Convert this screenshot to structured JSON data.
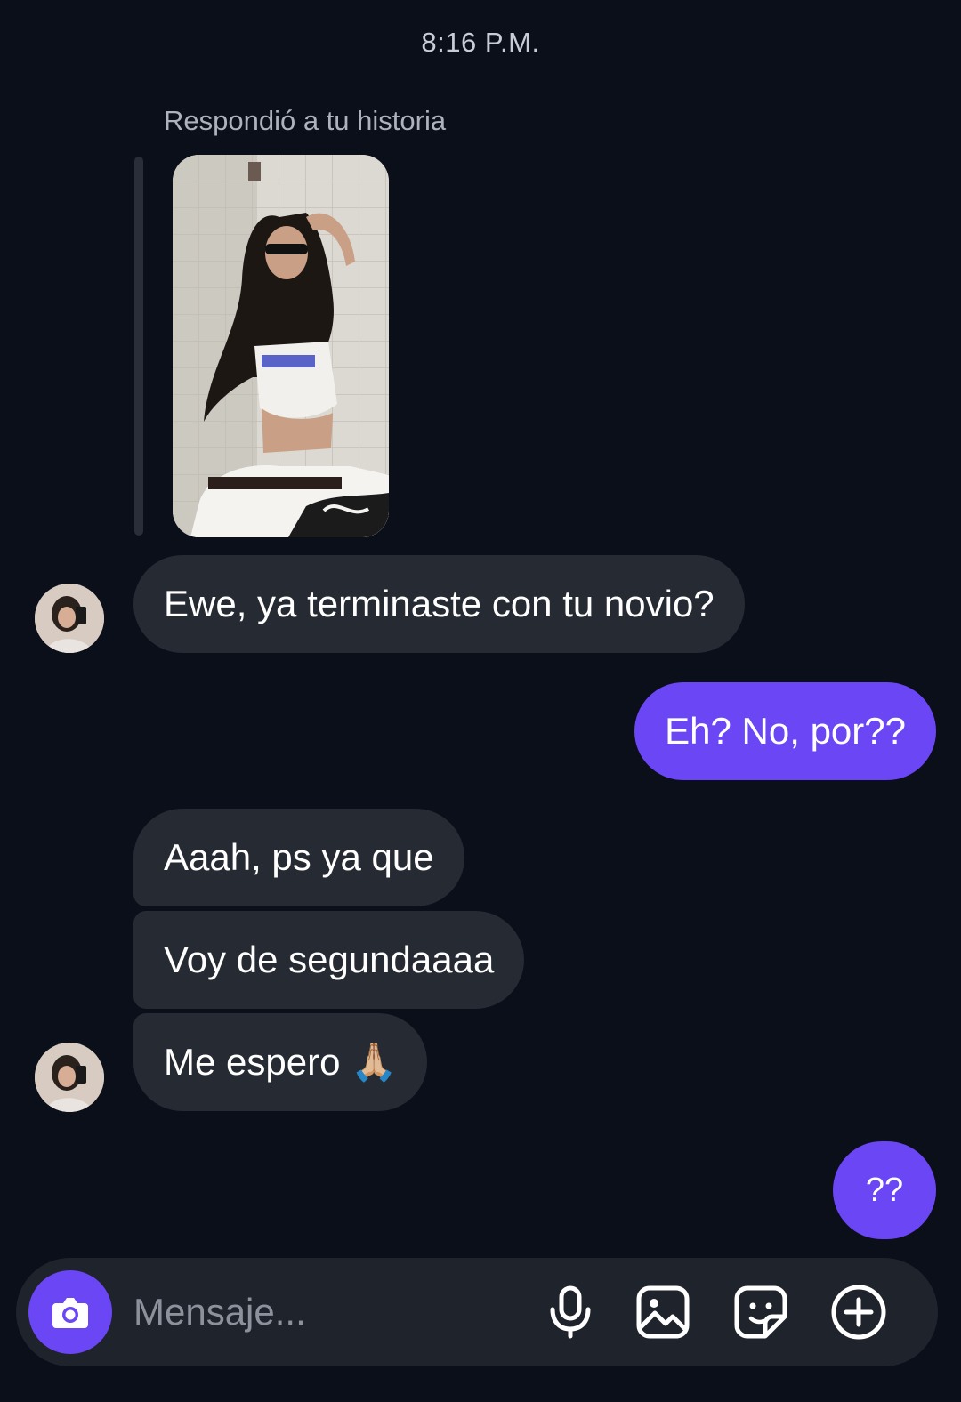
{
  "timestamp": "8:16 P.M.",
  "story_reply_label": "Respondió a tu historia",
  "messages": [
    {
      "from": "them",
      "text": "Ewe, ya terminaste con tu novio?"
    },
    {
      "from": "me",
      "text": "Eh? No, por??"
    },
    {
      "from": "them",
      "text": "Aaah, ps ya que"
    },
    {
      "from": "them",
      "text": "Voy de segundaaaa"
    },
    {
      "from": "them",
      "text": "Me espero 🙏🏼"
    },
    {
      "from": "me",
      "text": "??"
    }
  ],
  "composer": {
    "placeholder": "Mensaje...",
    "icons": [
      "camera-icon",
      "microphone-icon",
      "gallery-icon",
      "sticker-icon",
      "plus-circle-icon"
    ]
  },
  "colors": {
    "background": "#0b0f1a",
    "incoming_bubble": "#262a33",
    "outgoing_bubble": "#6a46f5",
    "composer": "#1f232c"
  }
}
